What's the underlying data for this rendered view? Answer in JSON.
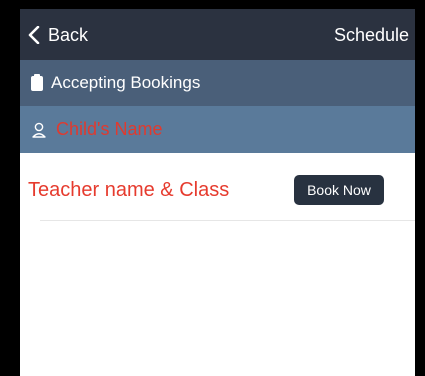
{
  "navbar": {
    "back_label": "Back",
    "back_icon": "chevron-left-icon",
    "schedule_label": "Schedule"
  },
  "status": {
    "icon": "clipboard-icon",
    "text": "Accepting Bookings"
  },
  "child": {
    "icon": "user-icon",
    "name": "Child's Name"
  },
  "booking": {
    "teacher_class": "Teacher name & Class",
    "book_label": "Book Now"
  },
  "colors": {
    "navbar_bg": "#2b3240",
    "status_bg": "#4a5f79",
    "child_bg": "#5a7a9a",
    "accent_red": "#e63b2e",
    "button_bg": "#283240"
  }
}
